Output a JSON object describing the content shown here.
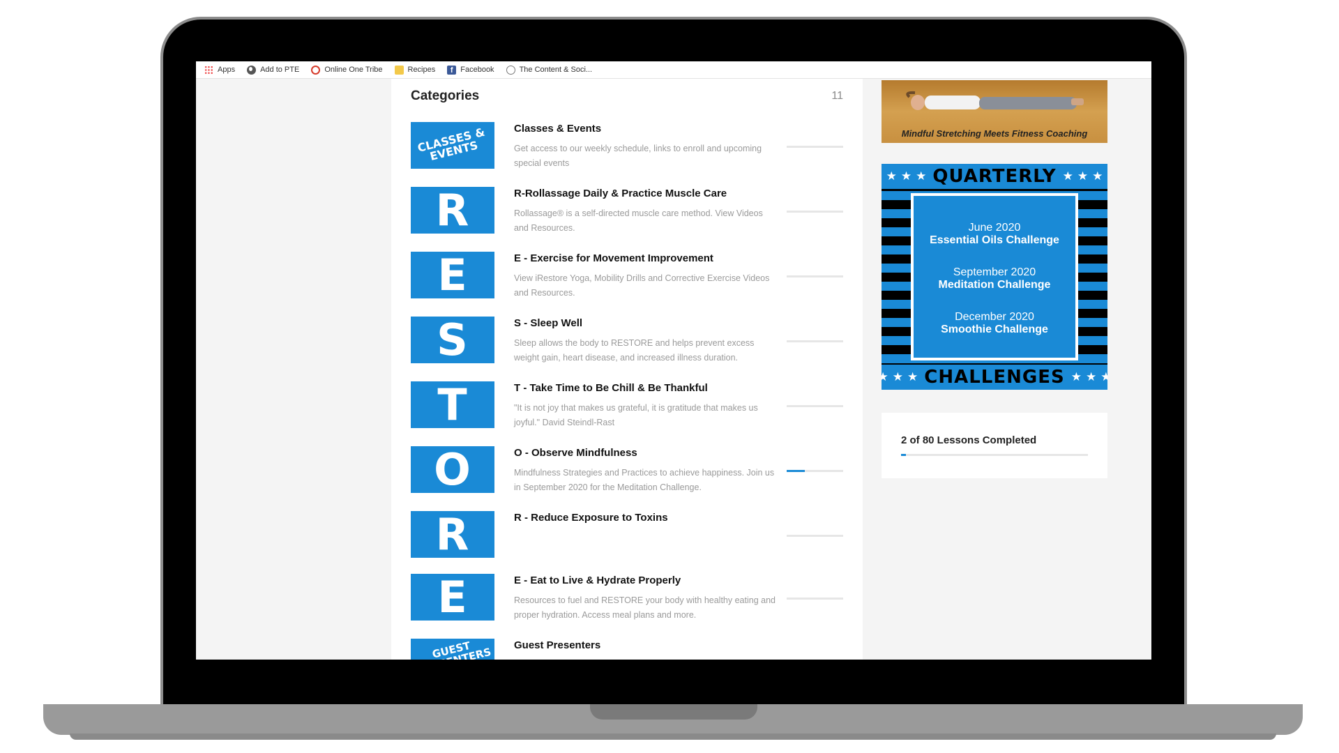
{
  "bookmarks": [
    {
      "label": "Apps",
      "icon": "apps-grid-icon"
    },
    {
      "label": "Add to PTE",
      "icon": "globe-icon"
    },
    {
      "label": "Online One Tribe",
      "icon": "ring-icon"
    },
    {
      "label": "Recipes",
      "icon": "folder-icon"
    },
    {
      "label": "Facebook",
      "icon": "facebook-icon"
    },
    {
      "label": "The Content & Soci...",
      "icon": "site-icon"
    }
  ],
  "categories": {
    "heading": "Categories",
    "count": "11",
    "items": [
      {
        "thumb": "CLASSES & EVENTS",
        "title": "Classes & Events",
        "desc": "Get access to our weekly schedule, links to enroll and upcoming special events",
        "progress": 0
      },
      {
        "thumb": "R",
        "title": "R-Rollassage Daily & Practice Muscle Care",
        "desc": "Rollassage® is a self-directed muscle care method. View Videos and Resources.",
        "progress": 0
      },
      {
        "thumb": "E",
        "title": "E - Exercise for Movement Improvement",
        "desc": "View iRestore Yoga, Mobility Drills and Corrective Exercise Videos and Resources.",
        "progress": 0
      },
      {
        "thumb": "S",
        "title": "S - Sleep Well",
        "desc": "Sleep allows the body to RESTORE and helps prevent excess weight gain, heart disease, and increased illness duration.",
        "progress": 0
      },
      {
        "thumb": "T",
        "title": "T - Take Time to Be Chill & Be Thankful",
        "desc": "\"It is not joy that makes us grateful, it is gratitude that makes us joyful.\" David Steindl-Rast",
        "progress": 0
      },
      {
        "thumb": "O",
        "title": "O - Observe Mindfulness",
        "desc": "Mindfulness Strategies and Practices to achieve happiness. Join us in September 2020 for the Meditation Challenge.",
        "progress": 0.32
      },
      {
        "thumb": "R",
        "title": "R - Reduce Exposure to Toxins",
        "desc": "",
        "progress": 0
      },
      {
        "thumb": "E",
        "title": "E - Eat to Live & Hydrate Properly",
        "desc": "Resources to fuel and RESTORE your body with healthy eating and proper hydration. Access meal plans and more.",
        "progress": 0
      },
      {
        "thumb": "GUEST PRESENTERS",
        "title": "Guest Presenters",
        "desc": "",
        "progress": 0
      }
    ]
  },
  "promo": {
    "caption": "Mindful Stretching Meets Fitness Coaching"
  },
  "quarterly": {
    "top": "QUARTERLY",
    "bottom": "CHALLENGES",
    "challenges": [
      {
        "date": "June 2020",
        "name": "Essential Oils Challenge"
      },
      {
        "date": "September 2020",
        "name": "Meditation Challenge"
      },
      {
        "date": "December 2020",
        "name": "Smoothie Challenge"
      }
    ]
  },
  "lessons": {
    "label": "2 of 80 Lessons Completed",
    "completed": 2,
    "total": 80
  },
  "colors": {
    "accent": "#1a8ad6",
    "bezel": "#000000",
    "body": "#9a9a9a"
  }
}
